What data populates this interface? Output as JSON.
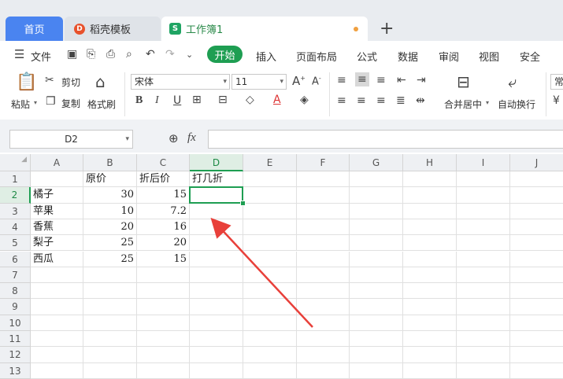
{
  "tabs": {
    "home": "首页",
    "doc": "稻壳模板",
    "book": "工作簿1",
    "plus": "+"
  },
  "menu": {
    "file": "文件",
    "start": "开始",
    "items": [
      "插入",
      "页面布局",
      "公式",
      "数据",
      "审阅",
      "视图",
      "安全"
    ]
  },
  "ribbon": {
    "paste": "粘贴",
    "cut": "剪切",
    "copy": "复制",
    "format_painter": "格式刷",
    "font_name": "宋体",
    "font_size": "11",
    "merge_center": "合并居中",
    "wrap": "自动换行",
    "overflow_label": "常"
  },
  "formula_bar": {
    "name_box": "D2",
    "fx": "fx",
    "content": ""
  },
  "grid": {
    "columns": [
      "A",
      "B",
      "C",
      "D",
      "E",
      "F",
      "G",
      "H",
      "I",
      "J"
    ],
    "rows": [
      "1",
      "2",
      "3",
      "4",
      "5",
      "6",
      "7",
      "8",
      "9",
      "10",
      "11",
      "12",
      "13"
    ],
    "selected_column": "D",
    "selected_row": "2",
    "headers": [
      "",
      "原价",
      "折后价",
      "打几折"
    ],
    "data": [
      [
        "橘子",
        "30",
        "15"
      ],
      [
        "苹果",
        "10",
        "7.2"
      ],
      [
        "香蕉",
        "20",
        "16"
      ],
      [
        "梨子",
        "25",
        "20"
      ],
      [
        "西瓜",
        "25",
        "15"
      ]
    ]
  },
  "colors": {
    "accent": "#1e9e52",
    "home_tab": "#4a84f0",
    "arrow": "#e8403a"
  }
}
